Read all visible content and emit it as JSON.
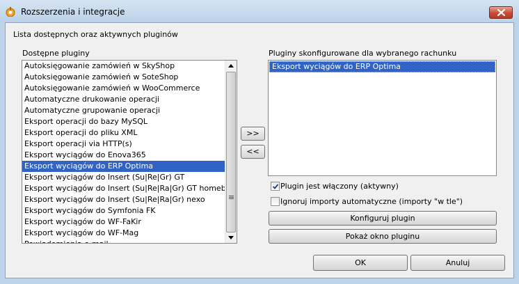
{
  "window": {
    "title": "Rozszerzenia i integracje"
  },
  "header": {
    "description": "Lista dostępnych oraz aktywnych pluginów"
  },
  "available": {
    "label": "Dostępne pluginy",
    "items": [
      "Autoksięgowanie zamówień w SkyShop",
      "Autoksięgowanie zamówień w SoteShop",
      "Autoksięgowanie zamówień w WooCommerce",
      "Automatyczne drukowanie operacji",
      "Automatyczne grupowanie operacji",
      "Eksport operacji do bazy MySQL",
      "Eksport operacji do pliku XML",
      "Eksport operacji via HTTP(s)",
      "Eksport wyciągów do Enova365",
      "Eksport wyciągów do ERP Optima",
      "Eksport wyciągów do Insert (Su|Re|Gr) GT",
      "Eksport wyciągów do Insert (Su|Re|Ra|Gr) GT homebanking",
      "Eksport wyciągów do Insert (Su|Re|Ra|Gr) nexo",
      "Eksport wyciągów do Symfonia FK",
      "Eksport wyciągów do WF-FaKir",
      "Eksport wyciągów do WF-Mag",
      "Powiadomienia e-mail"
    ],
    "selected": "Eksport wyciągów do ERP Optima"
  },
  "buttons": {
    "add": ">>",
    "remove": "<<",
    "configure": "Konfiguruj plugin",
    "show_window": "Pokaż okno pluginu",
    "ok": "OK",
    "cancel": "Anuluj"
  },
  "configured": {
    "label": "Pluginy skonfigurowane dla wybranego rachunku",
    "items": [
      "Eksport wyciągów do ERP Optima"
    ],
    "selected": "Eksport wyciągów do ERP Optima"
  },
  "options": {
    "enabled": {
      "label": "Plugin jest włączony (aktywny)",
      "checked": true
    },
    "ignore_imports": {
      "label": "Ignoruj importy automatyczne (importy \"w tle\")",
      "checked": false
    }
  }
}
